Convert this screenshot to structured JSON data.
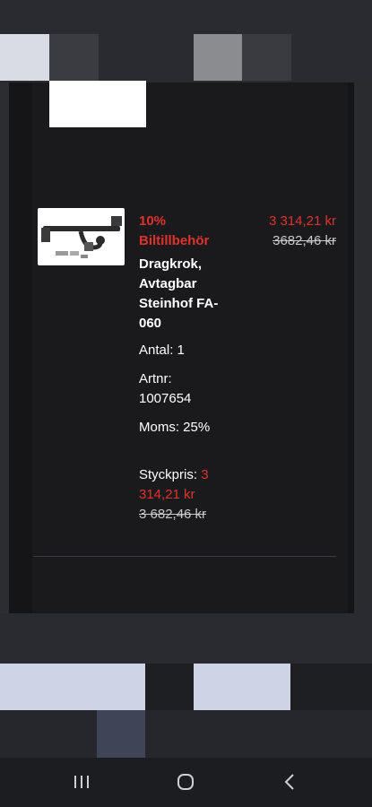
{
  "product": {
    "discount_line1": "10%",
    "discount_line2": "Biltillbehör",
    "title_lines": [
      "Dragkrok,",
      "Avtagbar",
      "Steinhof FA-",
      "060"
    ],
    "quantity": "Antal: 1",
    "article_label": "Artnr:",
    "article_number": "1007654",
    "vat": "Moms: 25%",
    "price_new": "3 314,21 kr",
    "price_old": "3682,46 kr",
    "unit_label": "Styckpris:",
    "unit_price_new_line1": "3",
    "unit_price_new_line2": "314,21 kr",
    "unit_price_old": "3 682,46 kr",
    "image_icon": "tow-hook-product-image"
  },
  "nav": {
    "recent_icon": "recent-apps-icon",
    "home_icon": "home-icon",
    "back_icon": "back-icon"
  },
  "colors": {
    "accent_red": "#e0322d",
    "panel_bg": "#1a1a1d",
    "page_bg": "#1e1f23"
  }
}
